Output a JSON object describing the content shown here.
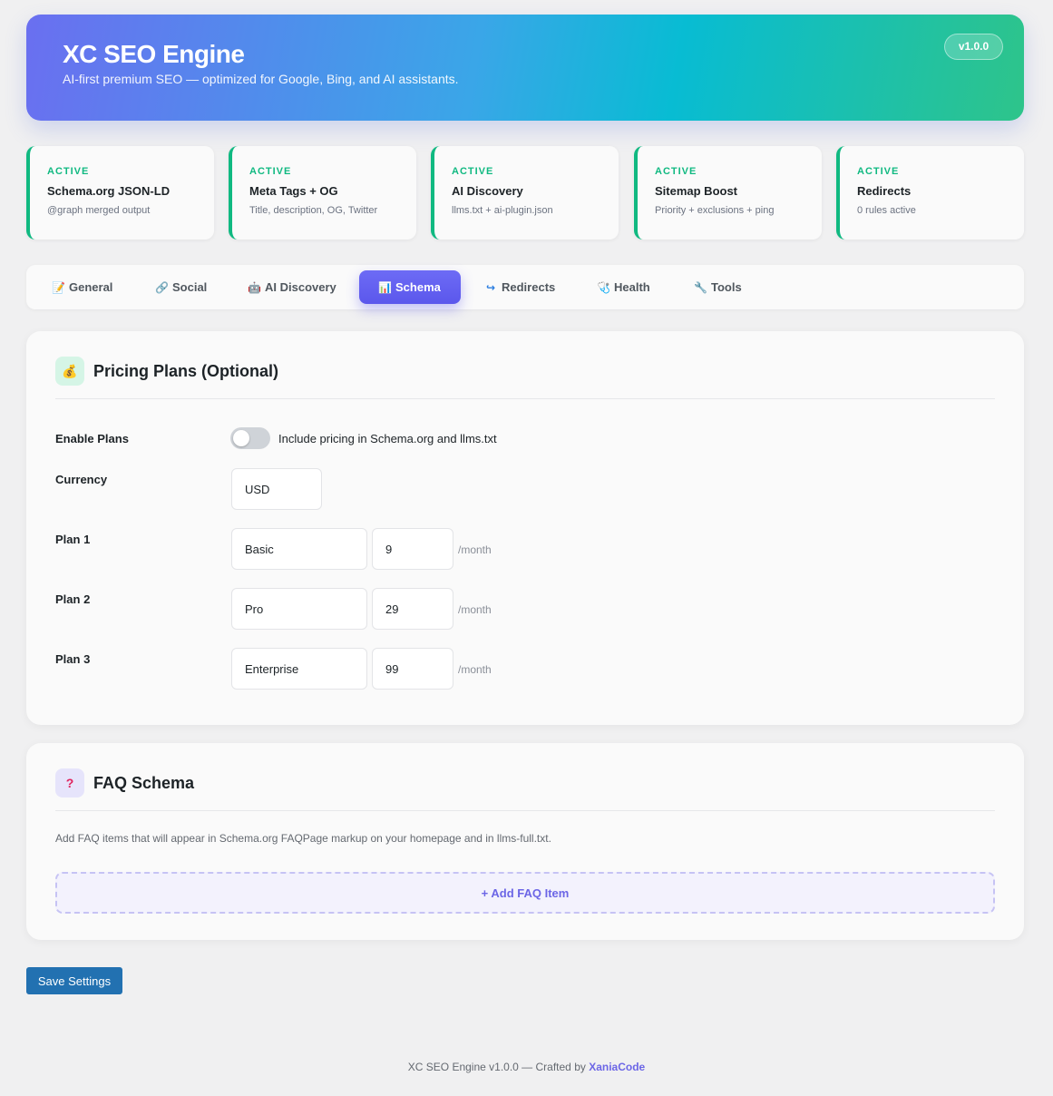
{
  "header": {
    "title": "XC SEO Engine",
    "subtitle": "AI-first premium SEO — optimized for Google, Bing, and AI assistants.",
    "version": "v1.0.0"
  },
  "modules": [
    {
      "status": "ACTIVE",
      "title": "Schema.org JSON-LD",
      "desc": "@graph merged output"
    },
    {
      "status": "ACTIVE",
      "title": "Meta Tags + OG",
      "desc": "Title, description, OG, Twitter"
    },
    {
      "status": "ACTIVE",
      "title": "AI Discovery",
      "desc": "llms.txt + ai-plugin.json"
    },
    {
      "status": "ACTIVE",
      "title": "Sitemap Boost",
      "desc": "Priority + exclusions + ping"
    },
    {
      "status": "ACTIVE",
      "title": "Redirects",
      "desc": "0 rules active"
    }
  ],
  "tabs": [
    {
      "label": "General",
      "icon": "📝"
    },
    {
      "label": "Social",
      "icon": "🔗"
    },
    {
      "label": "AI Discovery",
      "icon": "🤖"
    },
    {
      "label": "Schema",
      "icon": "📊",
      "active": true
    },
    {
      "label": "Redirects",
      "icon": "↪"
    },
    {
      "label": "Health",
      "icon": "🩺"
    },
    {
      "label": "Tools",
      "icon": "🔧"
    }
  ],
  "pricing": {
    "icon": "💰",
    "title": "Pricing Plans (Optional)",
    "enable_label": "Enable Plans",
    "enable_text": "Include pricing in Schema.org and llms.txt",
    "enabled": false,
    "currency_label": "Currency",
    "currency": "USD",
    "plans": [
      {
        "label": "Plan 1",
        "name": "Basic",
        "price": "9",
        "period": "/month"
      },
      {
        "label": "Plan 2",
        "name": "Pro",
        "price": "29",
        "period": "/month"
      },
      {
        "label": "Plan 3",
        "name": "Enterprise",
        "price": "99",
        "period": "/month"
      }
    ]
  },
  "faq": {
    "icon": "?",
    "title": "FAQ Schema",
    "description": "Add FAQ items that will appear in Schema.org FAQPage markup on your homepage and in llms-full.txt.",
    "add_label": "+ Add FAQ Item"
  },
  "save_label": "Save Settings",
  "footer": {
    "text": "XC SEO Engine v1.0.0 — Crafted by",
    "brand": "XaniaCode"
  },
  "colors": {
    "accent": "#5b57ec",
    "active_status": "#10b981",
    "save_button": "#2271b1"
  }
}
